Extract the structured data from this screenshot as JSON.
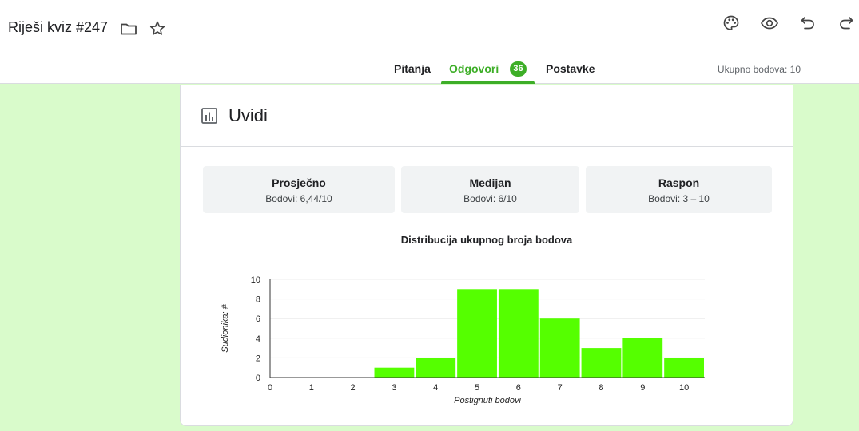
{
  "header": {
    "title": "Riješi kviz #247",
    "tabs": [
      {
        "label": "Pitanja"
      },
      {
        "label": "Odgovori",
        "badge": "36"
      },
      {
        "label": "Postavke"
      }
    ],
    "total_points": "Ukupno bodova: 10"
  },
  "colors": {
    "accent": "#3dae27",
    "bar": "#55ff00",
    "page_bg": "#d9fbcb"
  },
  "insights": {
    "title": "Uvidi",
    "stats": [
      {
        "title": "Prosječno",
        "value": "Bodovi: 6,44/10"
      },
      {
        "title": "Medijan",
        "value": "Bodovi: 6/10"
      },
      {
        "title": "Raspon",
        "value": "Bodovi: 3 – 10"
      }
    ]
  },
  "chart_data": {
    "type": "bar",
    "title": "Distribucija ukupnog broja bodova",
    "xlabel": "Postignuti bodovi",
    "ylabel": "Sudionika: #",
    "categories": [
      "0",
      "1",
      "2",
      "3",
      "4",
      "5",
      "6",
      "7",
      "8",
      "9",
      "10"
    ],
    "values": [
      0,
      0,
      0,
      1,
      2,
      9,
      9,
      6,
      3,
      4,
      2
    ],
    "ylim": [
      0,
      10
    ],
    "yticks": [
      0,
      2,
      4,
      6,
      8,
      10
    ],
    "grid": true
  }
}
